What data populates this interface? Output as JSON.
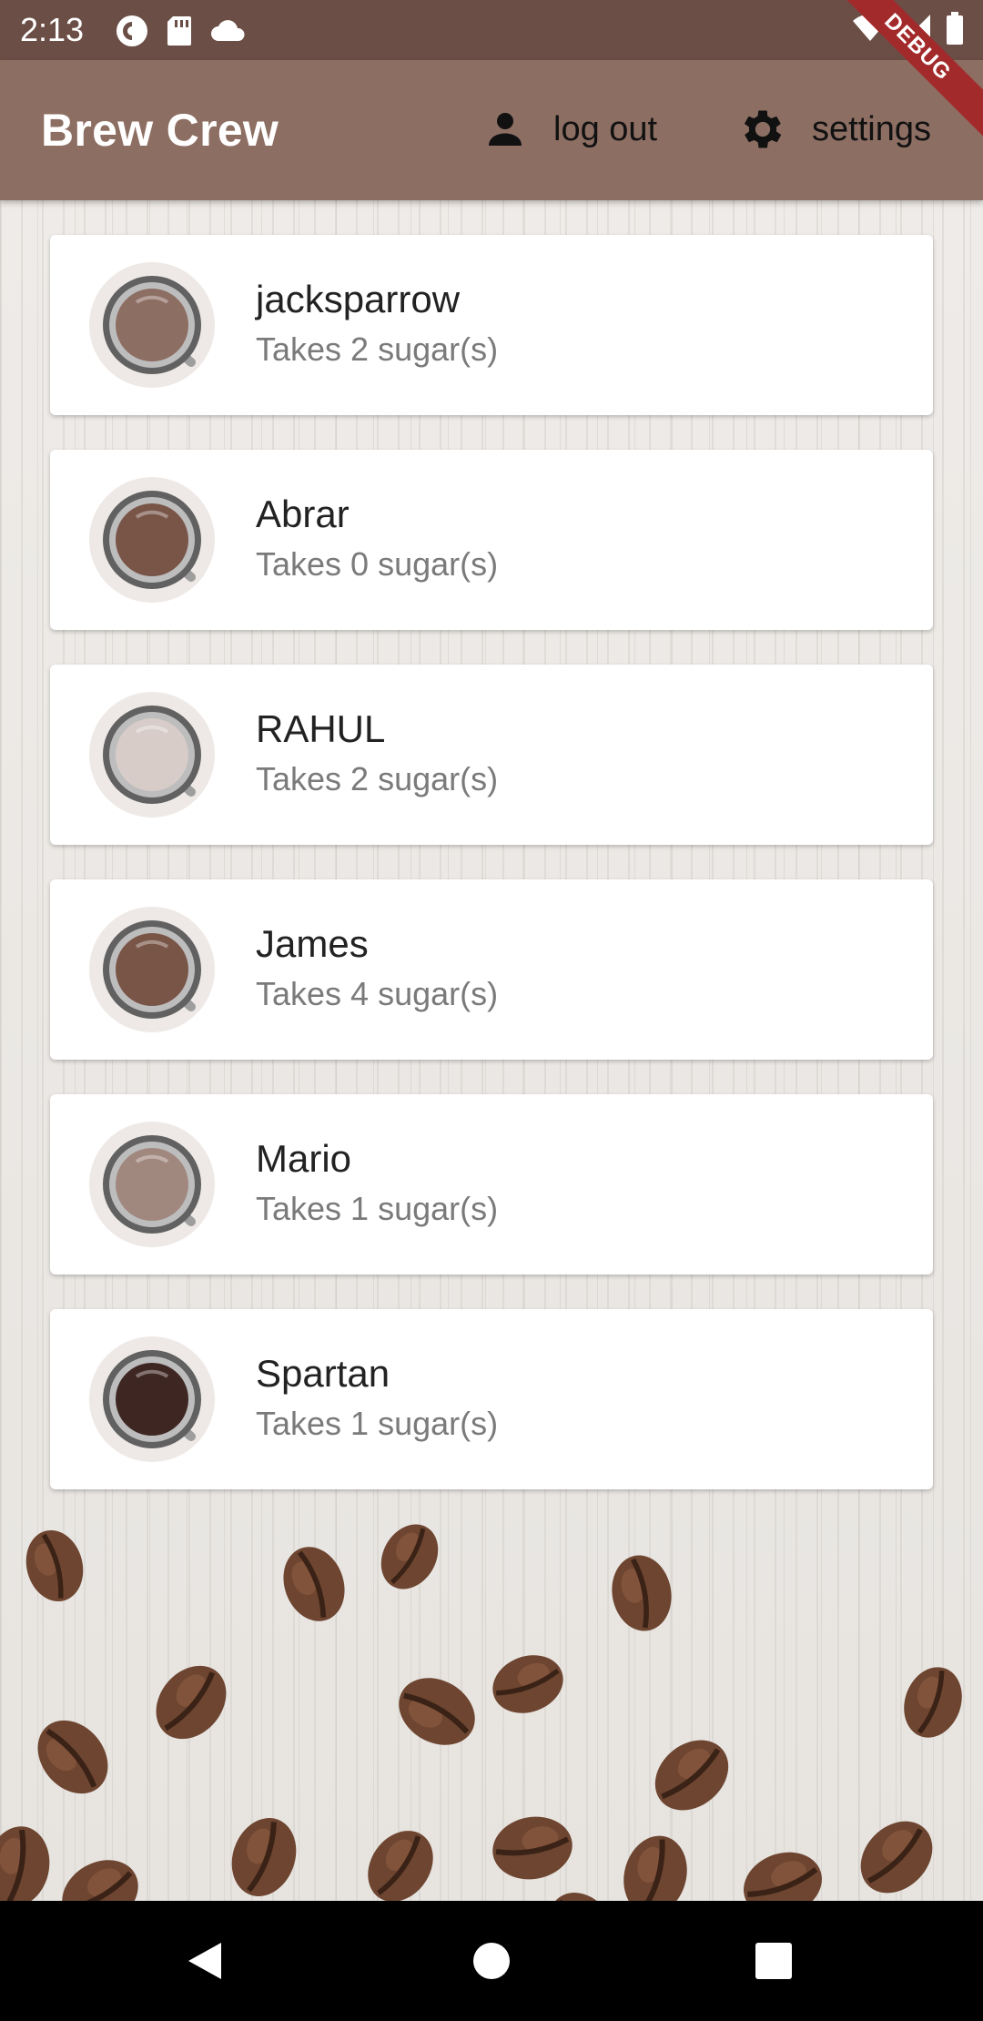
{
  "status_bar": {
    "time": "2:13",
    "left_icons": [
      "pocket-casts-icon",
      "sd-card-icon",
      "cloud-icon"
    ],
    "right_icons": [
      "wifi-icon",
      "signal-icon",
      "battery-icon"
    ]
  },
  "debug_banner": "DEBUG",
  "app_bar": {
    "title": "Brew Crew",
    "actions": [
      {
        "icon": "person-icon",
        "label": "log out"
      },
      {
        "icon": "gear-icon",
        "label": "settings"
      }
    ]
  },
  "brews": [
    {
      "name": "jacksparrow",
      "subtitle": "Takes 2 sugar(s)",
      "color": "#8d6e63"
    },
    {
      "name": "Abrar",
      "subtitle": "Takes 0 sugar(s)",
      "color": "#795548"
    },
    {
      "name": "RAHUL",
      "subtitle": "Takes 2 sugar(s)",
      "color": "#d7ccc8"
    },
    {
      "name": "James",
      "subtitle": "Takes 4 sugar(s)",
      "color": "#795548"
    },
    {
      "name": "Mario",
      "subtitle": "Takes 1 sugar(s)",
      "color": "#a1887f"
    },
    {
      "name": "Spartan",
      "subtitle": "Takes 1 sugar(s)",
      "color": "#3e2723"
    }
  ],
  "colors": {
    "status_bar": "#6b4e45",
    "app_bar": "#8d6e63",
    "debug_ribbon": "#a32a2a"
  },
  "nav_bar": {
    "buttons": [
      "back-icon",
      "home-icon",
      "recents-icon"
    ]
  }
}
